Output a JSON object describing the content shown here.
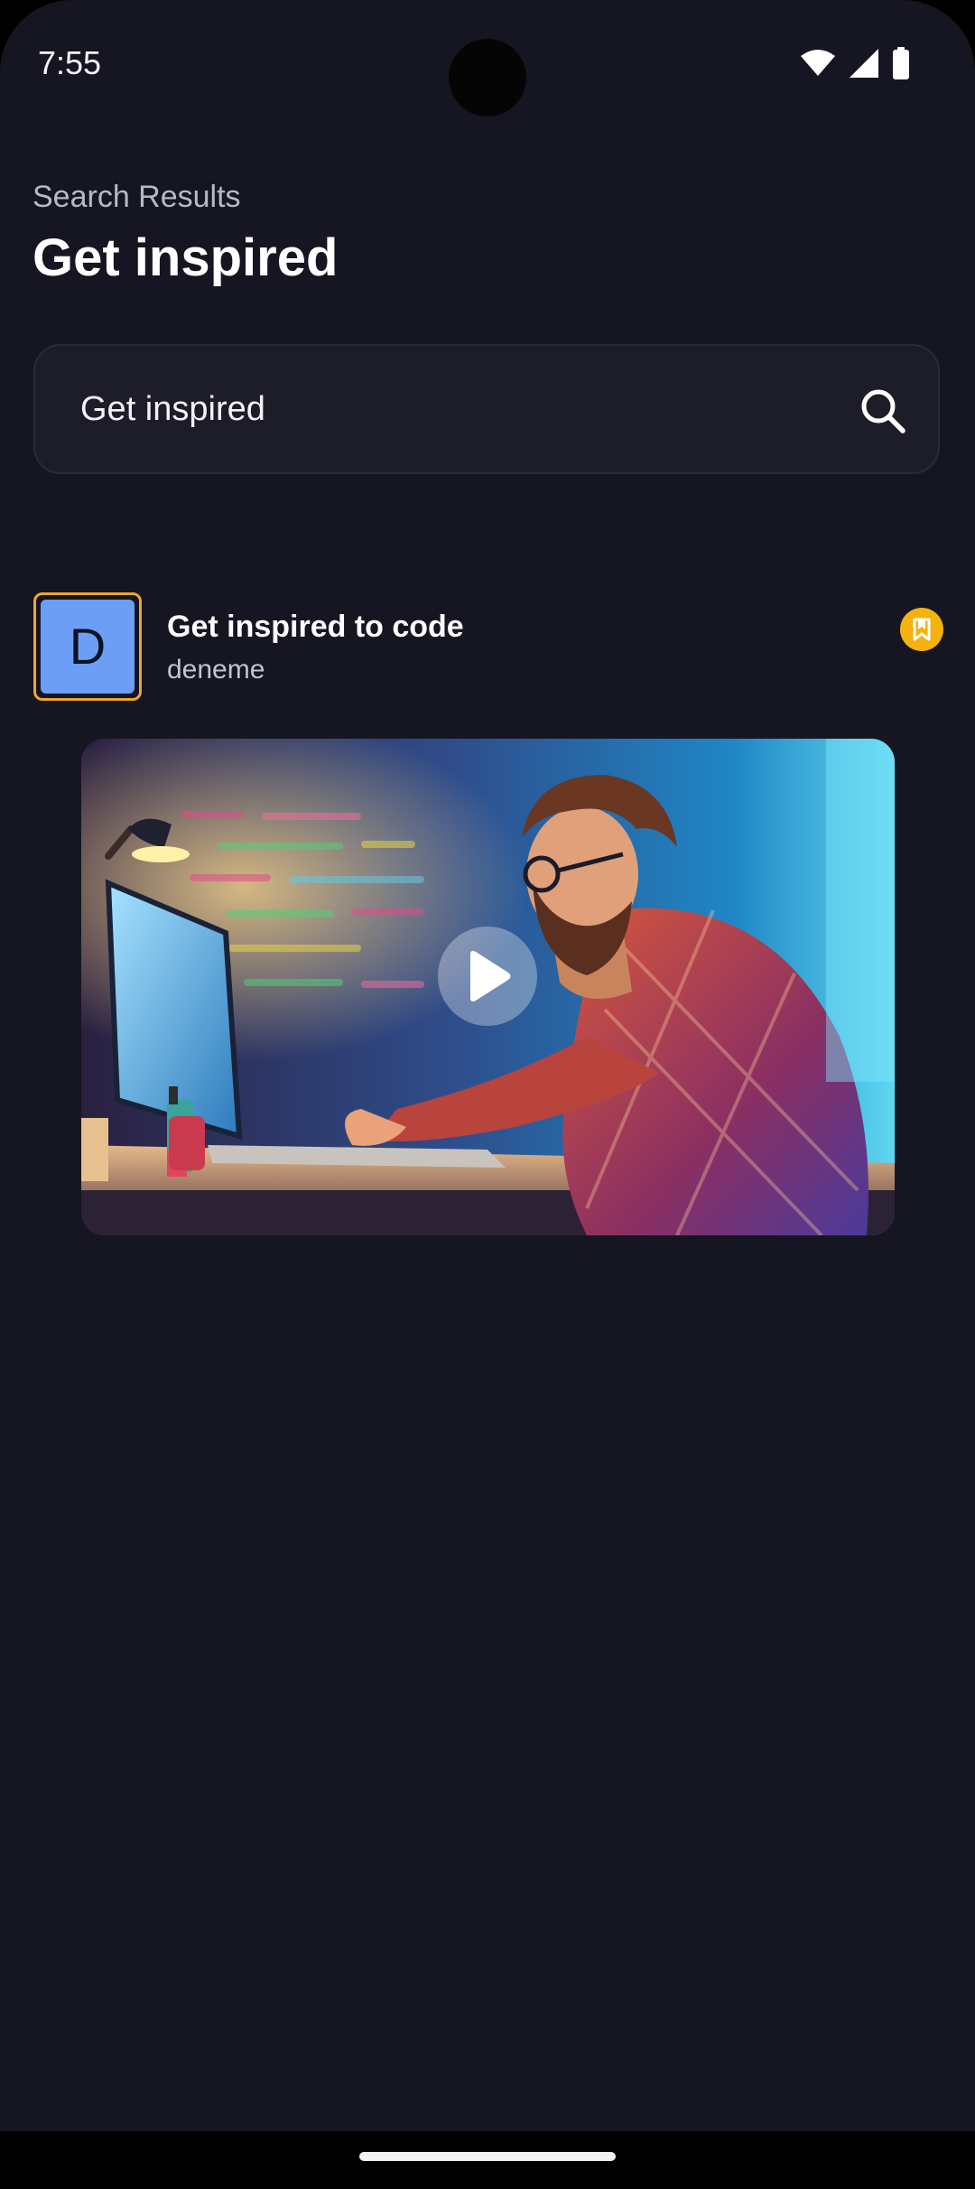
{
  "status_bar": {
    "time": "7:55",
    "icons": [
      "wifi-icon",
      "signal-icon",
      "battery-icon"
    ]
  },
  "header": {
    "subtitle": "Search Results",
    "title": "Get inspired"
  },
  "search": {
    "value": "Get inspired",
    "icon": "search-icon"
  },
  "results": [
    {
      "avatar_letter": "D",
      "title": "Get inspired to code",
      "author": "deneme",
      "bookmark_icon": "bookmark-icon",
      "media": "video-thumbnail",
      "play_icon": "play-icon"
    }
  ],
  "colors": {
    "background": "#161622",
    "search_background": "#1d1d2a",
    "accent": "#f5b20f",
    "avatar_border": "#f0a531",
    "avatar_fill": "#6c9ef5"
  }
}
